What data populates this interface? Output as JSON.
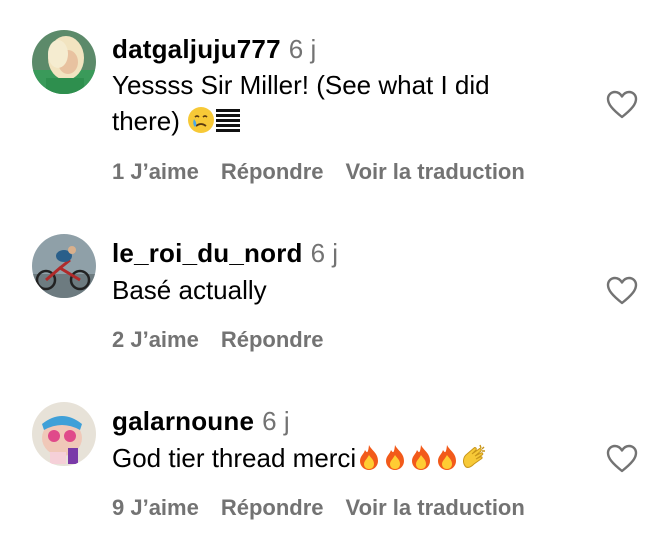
{
  "comments": [
    {
      "username": "datgaljuju777",
      "time": "6 j",
      "text_line1": "Yessss Sir Miller! (See what I did",
      "text_line2": "there)",
      "emojis": [
        "crying-face",
        "stacked-lines"
      ],
      "likes": "1 J’aime",
      "reply": "Répondre",
      "translate": "Voir la traduction"
    },
    {
      "username": "le_roi_du_nord",
      "time": "6 j",
      "text_line1": "Basé actually",
      "likes": "2 J’aime",
      "reply": "Répondre"
    },
    {
      "username": "galarnoune",
      "time": "6 j",
      "text_line1": "God tier thread merci",
      "emojis": [
        "fire",
        "fire",
        "fire",
        "fire",
        "clapping-hands"
      ],
      "likes": "9 J’aime",
      "reply": "Répondre",
      "translate": "Voir la traduction"
    }
  ],
  "colors": {
    "secondary_text": "#737373",
    "heart_outline": "#737373"
  }
}
